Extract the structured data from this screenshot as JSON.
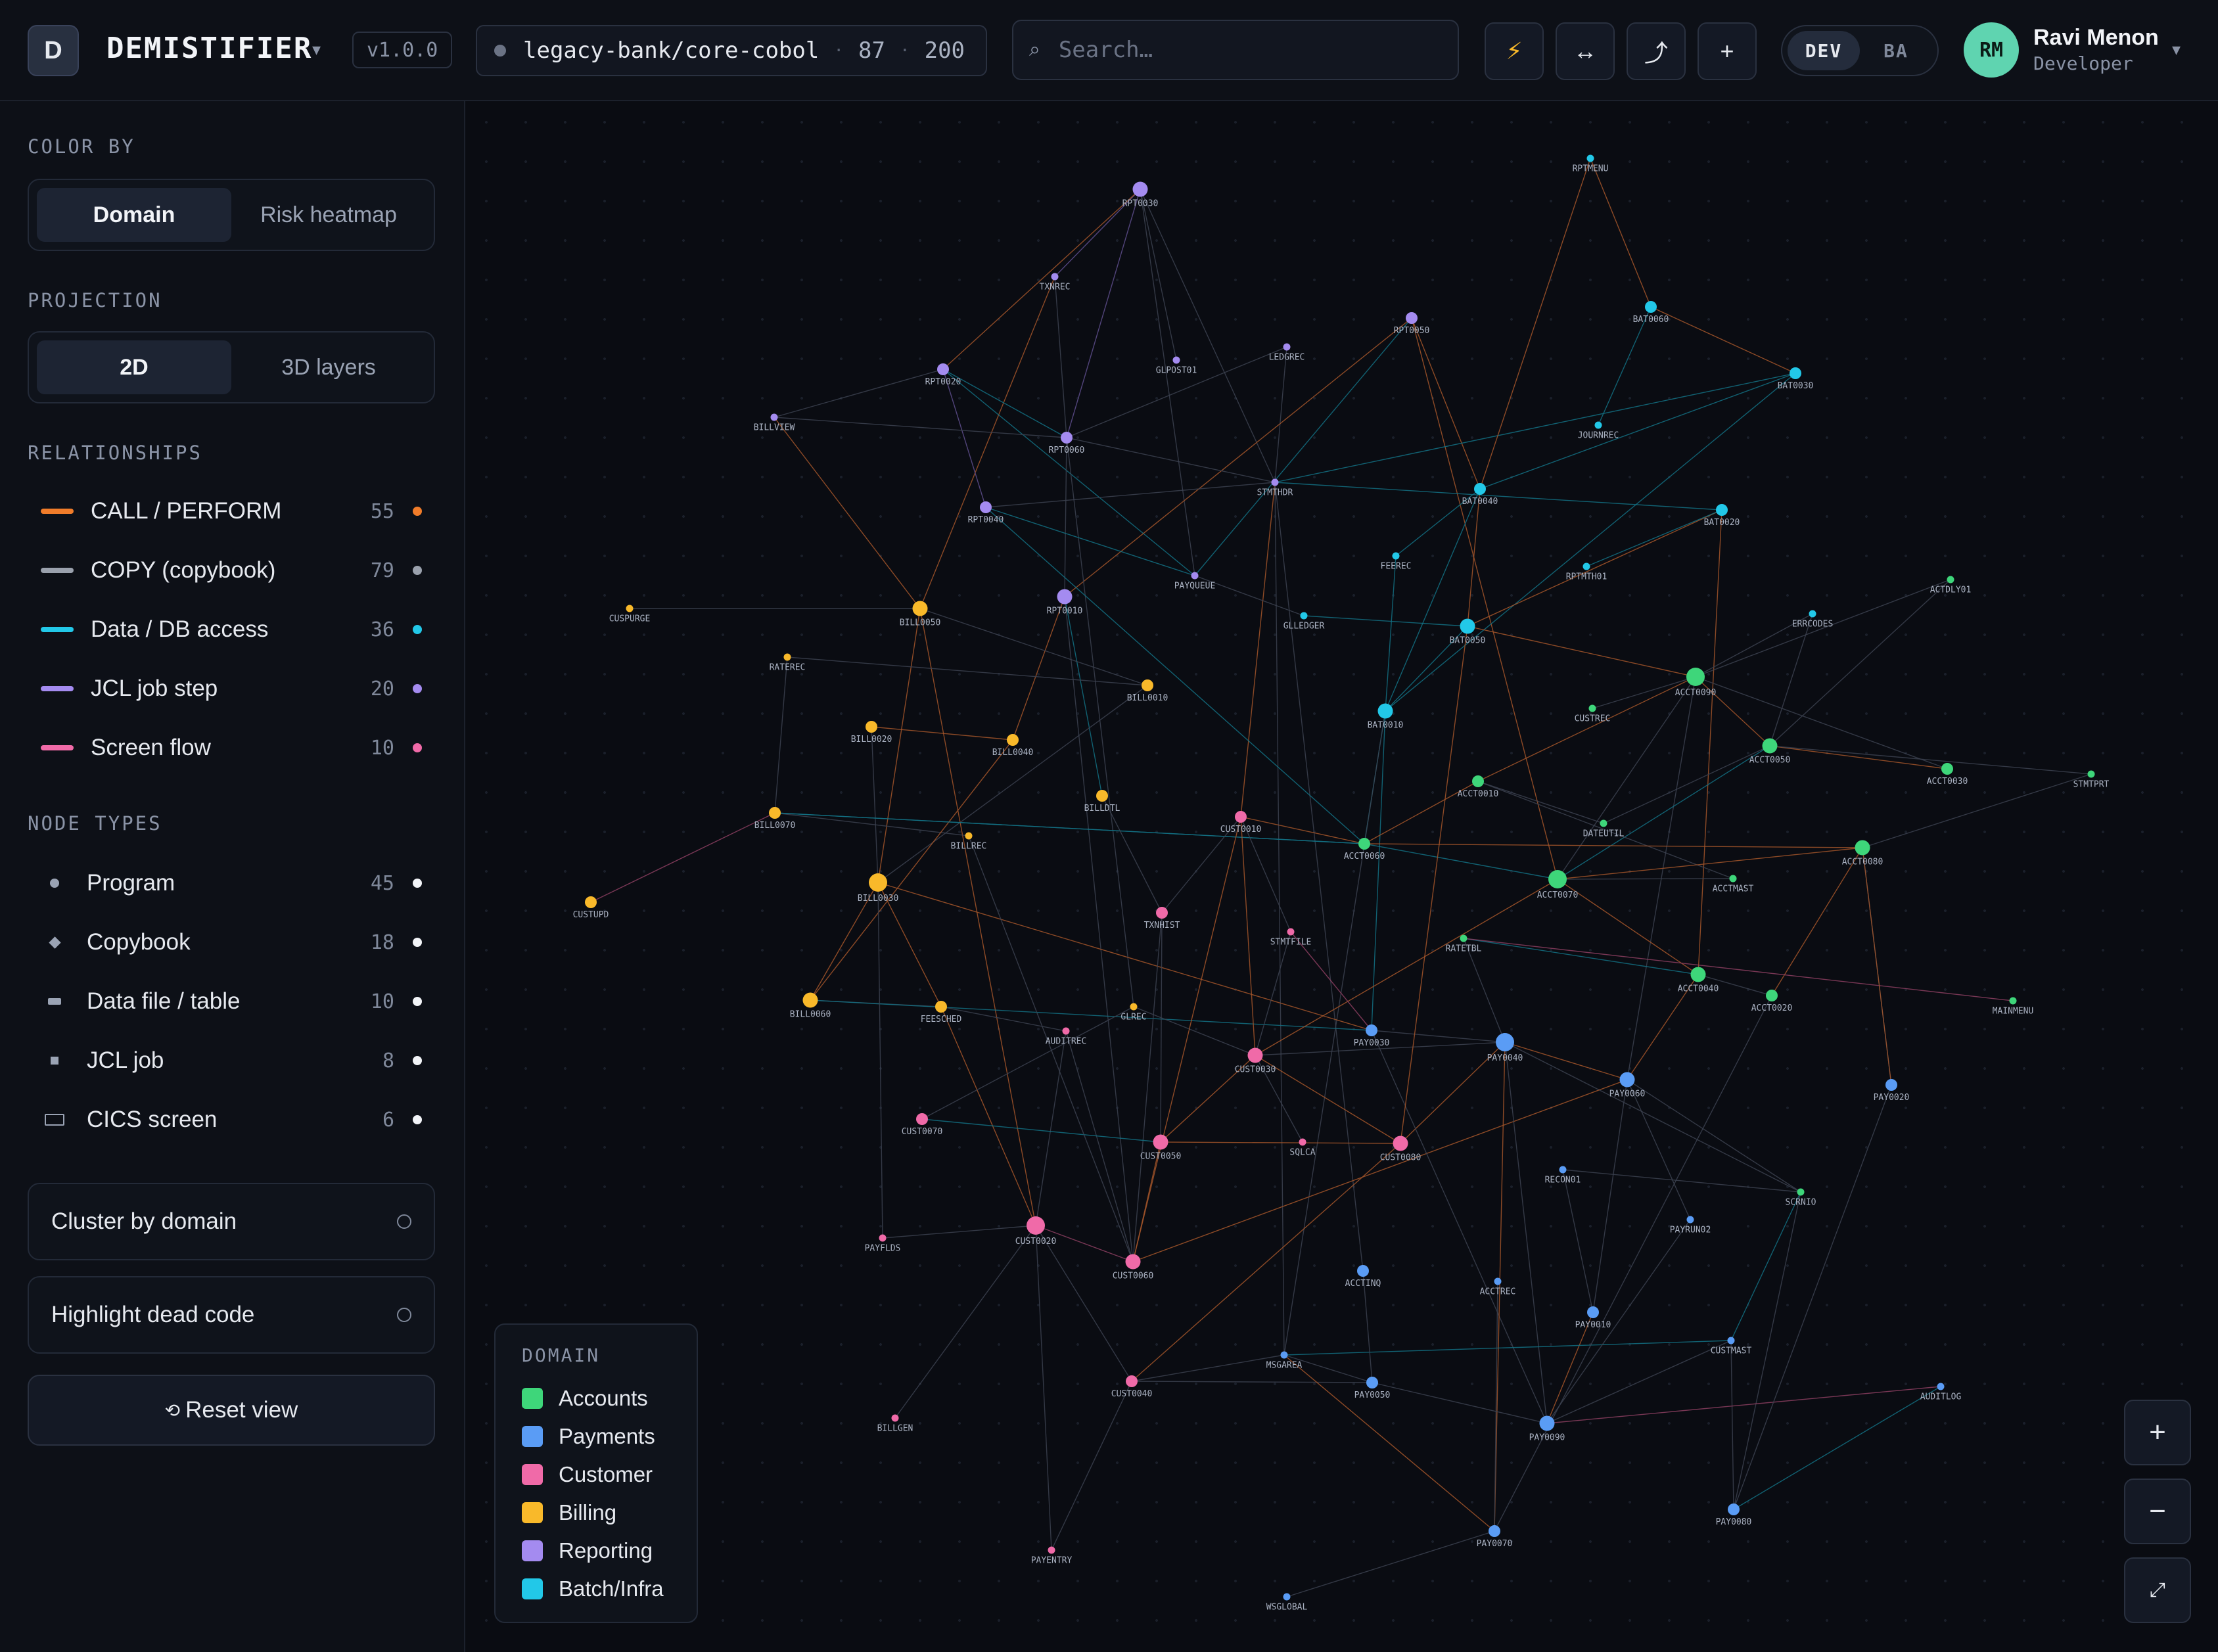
{
  "header": {
    "logo_letter": "D",
    "app_name": "DEMISTIFIER",
    "version": "v1.0.0",
    "repo": {
      "name": "legacy-bank/core-cobol",
      "nodes": "87",
      "edges": "200"
    },
    "search_placeholder": "Search…",
    "tools": [
      {
        "icon": "lightning-icon",
        "glyph": "⚡"
      },
      {
        "icon": "swap-arrows-icon",
        "glyph": "↔"
      },
      {
        "icon": "path-curve-icon",
        "glyph": "⤴"
      },
      {
        "icon": "plus-icon",
        "glyph": "+"
      }
    ],
    "mode": {
      "options": [
        "DEV",
        "BA"
      ],
      "active": "DEV"
    },
    "user": {
      "initials": "RM",
      "name": "Ravi Menon",
      "role": "Developer"
    }
  },
  "sidebar": {
    "color_by": {
      "title": "COLOR BY",
      "options": [
        "Domain",
        "Risk heatmap"
      ],
      "active": "Domain"
    },
    "projection": {
      "title": "PROJECTION",
      "options": [
        "2D",
        "3D layers"
      ],
      "active": "2D"
    },
    "relationships": {
      "title": "RELATIONSHIPS",
      "items": [
        {
          "label": "CALL / PERFORM",
          "count": "55",
          "color": "#f07c2a"
        },
        {
          "label": "COPY (copybook)",
          "count": "79",
          "color": "#9aa1ad"
        },
        {
          "label": "Data / DB access",
          "count": "36",
          "color": "#22c8e8"
        },
        {
          "label": "JCL job step",
          "count": "20",
          "color": "#a48bf0"
        },
        {
          "label": "Screen flow",
          "count": "10",
          "color": "#f06aa8"
        }
      ]
    },
    "node_types": {
      "title": "NODE TYPES",
      "items": [
        {
          "label": "Program",
          "count": "45",
          "shape": "circle"
        },
        {
          "label": "Copybook",
          "count": "18",
          "shape": "diamond"
        },
        {
          "label": "Data file / table",
          "count": "10",
          "shape": "bar"
        },
        {
          "label": "JCL job",
          "count": "8",
          "shape": "square"
        },
        {
          "label": "CICS screen",
          "count": "6",
          "shape": "rect"
        }
      ]
    },
    "cluster_label": "Cluster by domain",
    "dead_code_label": "Highlight dead code",
    "reset_icon": "⟲",
    "reset_label": "Reset view"
  },
  "legend": {
    "title": "DOMAIN",
    "items": [
      {
        "name": "Accounts",
        "color": "#3ed67a"
      },
      {
        "name": "Payments",
        "color": "#5a9cf5"
      },
      {
        "name": "Customer",
        "color": "#f06aa8"
      },
      {
        "name": "Billing",
        "color": "#f9b92a"
      },
      {
        "name": "Reporting",
        "color": "#a48bf0"
      },
      {
        "name": "Batch/Infra",
        "color": "#22c8e8"
      }
    ]
  },
  "zoom": {
    "in": "+",
    "out": "−",
    "fit": "⤢"
  },
  "graph": {
    "domain_colors": {
      "Accounts": "#3ed67a",
      "Payments": "#5a9cf5",
      "Customer": "#f06aa8",
      "Billing": "#f9b92a",
      "Reporting": "#a48bf0",
      "Batch/Infra": "#22c8e8"
    },
    "nodes": [
      [
        "RPT0030",
        "Reporting",
        "l"
      ],
      [
        "TXNREC",
        "Reporting",
        "s"
      ],
      [
        "RPT0020",
        "Reporting",
        "m"
      ],
      [
        "GLPOST01",
        "Reporting",
        "s"
      ],
      [
        "LEDGREC",
        "Reporting",
        "s"
      ],
      [
        "RPT0050",
        "Reporting",
        "m"
      ],
      [
        "BILLVIEW",
        "Reporting",
        "s"
      ],
      [
        "RPT0060",
        "Reporting",
        "m"
      ],
      [
        "STMTHDR",
        "Reporting",
        "s"
      ],
      [
        "RPT0040",
        "Reporting",
        "m"
      ],
      [
        "RPT0010",
        "Reporting",
        "l"
      ],
      [
        "PAYQUEUE",
        "Reporting",
        "s"
      ],
      [
        "RPTMENU",
        "Batch/Infra",
        "s"
      ],
      [
        "BAT0060",
        "Batch/Infra",
        "m"
      ],
      [
        "BAT0030",
        "Batch/Infra",
        "m"
      ],
      [
        "JOURNREC",
        "Batch/Infra",
        "s"
      ],
      [
        "BAT0040",
        "Batch/Infra",
        "m"
      ],
      [
        "BAT0020",
        "Batch/Infra",
        "m"
      ],
      [
        "FEEREC",
        "Batch/Infra",
        "s"
      ],
      [
        "RPTMTH01",
        "Batch/Infra",
        "s"
      ],
      [
        "GLLEDGER",
        "Batch/Infra",
        "s"
      ],
      [
        "BAT0050",
        "Batch/Infra",
        "l"
      ],
      [
        "ERRCODES",
        "Batch/Infra",
        "s"
      ],
      [
        "BAT0010",
        "Batch/Infra",
        "l"
      ],
      [
        "CUSPURGE",
        "Billing",
        "s"
      ],
      [
        "BILL0050",
        "Billing",
        "l"
      ],
      [
        "RATEREC",
        "Billing",
        "s"
      ],
      [
        "BILL0010",
        "Billing",
        "m"
      ],
      [
        "BILL0020",
        "Billing",
        "m"
      ],
      [
        "BILL0040",
        "Billing",
        "m"
      ],
      [
        "BILLDTL",
        "Billing",
        "m"
      ],
      [
        "BILL0070",
        "Billing",
        "m"
      ],
      [
        "BILLREC",
        "Billing",
        "s"
      ],
      [
        "CUSTUPD",
        "Billing",
        "m"
      ],
      [
        "BILL0030",
        "Billing",
        "xl"
      ],
      [
        "BILL0060",
        "Billing",
        "l"
      ],
      [
        "FEESCHED",
        "Billing",
        "m"
      ],
      [
        "GLREC",
        "Billing",
        "s"
      ],
      [
        "ACTDLY01",
        "Accounts",
        "s"
      ],
      [
        "ACCT0090",
        "Accounts",
        "xl"
      ],
      [
        "CUSTREC",
        "Accounts",
        "s"
      ],
      [
        "ACCT0050",
        "Accounts",
        "l"
      ],
      [
        "ACCT0030",
        "Accounts",
        "m"
      ],
      [
        "STMTPRT",
        "Accounts",
        "s"
      ],
      [
        "ACCT0010",
        "Accounts",
        "m"
      ],
      [
        "DATEUTIL",
        "Accounts",
        "s"
      ],
      [
        "ACCT0060",
        "Accounts",
        "m"
      ],
      [
        "ACCT0070",
        "Accounts",
        "xl"
      ],
      [
        "ACCTMAST",
        "Accounts",
        "s"
      ],
      [
        "ACCT0080",
        "Accounts",
        "l"
      ],
      [
        "RATETBL",
        "Accounts",
        "s"
      ],
      [
        "ACCT0040",
        "Accounts",
        "l"
      ],
      [
        "ACCT0020",
        "Accounts",
        "m"
      ],
      [
        "MAINMENU",
        "Accounts",
        "s"
      ],
      [
        "SCRNIO",
        "Accounts",
        "s"
      ],
      [
        "CUST0010",
        "Customer",
        "m"
      ],
      [
        "TXNHIST",
        "Customer",
        "m"
      ],
      [
        "STMTFILE",
        "Customer",
        "s"
      ],
      [
        "AUDITREC",
        "Customer",
        "s"
      ],
      [
        "CUST0030",
        "Customer",
        "l"
      ],
      [
        "CUST0070",
        "Customer",
        "m"
      ],
      [
        "CUST0050",
        "Customer",
        "l"
      ],
      [
        "SQLCA",
        "Customer",
        "s"
      ],
      [
        "CUST0080",
        "Customer",
        "l"
      ],
      [
        "PAYFLDS",
        "Customer",
        "s"
      ],
      [
        "CUST0020",
        "Customer",
        "xl"
      ],
      [
        "CUST0060",
        "Customer",
        "l"
      ],
      [
        "CUST0040",
        "Customer",
        "m"
      ],
      [
        "BILLGEN",
        "Customer",
        "s"
      ],
      [
        "PAYENTRY",
        "Customer",
        "s"
      ],
      [
        "PAY0030",
        "Payments",
        "m"
      ],
      [
        "PAY0040",
        "Payments",
        "xl"
      ],
      [
        "PAY0060",
        "Payments",
        "l"
      ],
      [
        "PAY0020",
        "Payments",
        "m"
      ],
      [
        "RECON01",
        "Payments",
        "s"
      ],
      [
        "PAYRUN02",
        "Payments",
        "s"
      ],
      [
        "ACCTINQ",
        "Payments",
        "m"
      ],
      [
        "ACCTREC",
        "Payments",
        "s"
      ],
      [
        "PAY0010",
        "Payments",
        "m"
      ],
      [
        "CUSTMAST",
        "Payments",
        "s"
      ],
      [
        "MSGAREA",
        "Payments",
        "s"
      ],
      [
        "PAY0050",
        "Payments",
        "m"
      ],
      [
        "PAY0090",
        "Payments",
        "l"
      ],
      [
        "AUDITLOG",
        "Payments",
        "s"
      ],
      [
        "PAY0080",
        "Payments",
        "m"
      ],
      [
        "PAY0070",
        "Payments",
        "m"
      ],
      [
        "WSGLOBAL",
        "Payments",
        "s"
      ]
    ]
  }
}
